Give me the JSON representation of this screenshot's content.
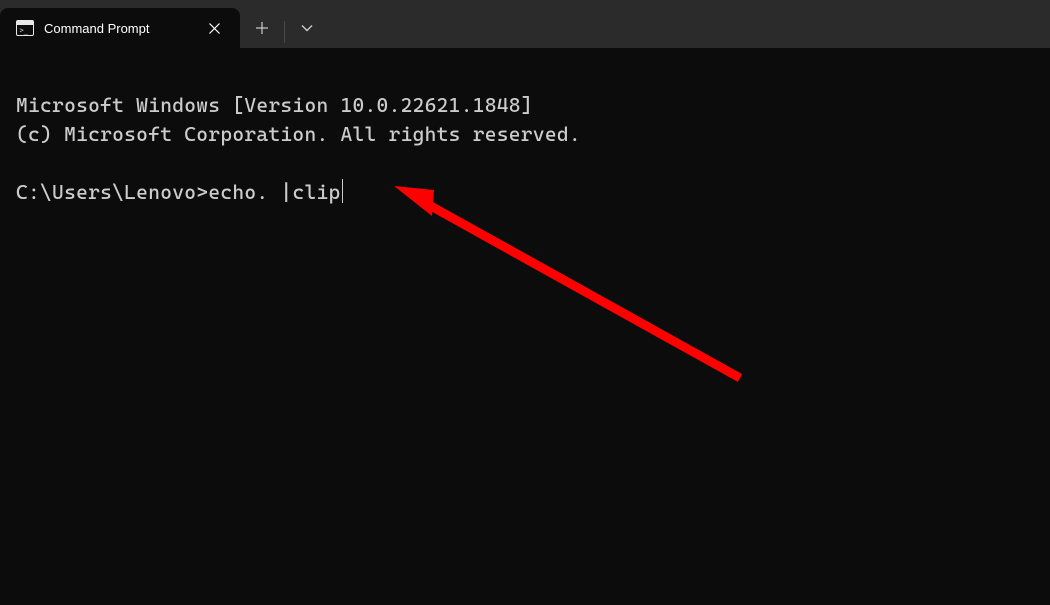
{
  "tab": {
    "title": "Command Prompt"
  },
  "terminal": {
    "line1": "Microsoft Windows [Version 10.0.22621.1848]",
    "line2": "(c) Microsoft Corporation. All rights reserved.",
    "blank": "",
    "prompt": "C:\\Users\\Lenovo>",
    "command": "echo. |clip"
  }
}
